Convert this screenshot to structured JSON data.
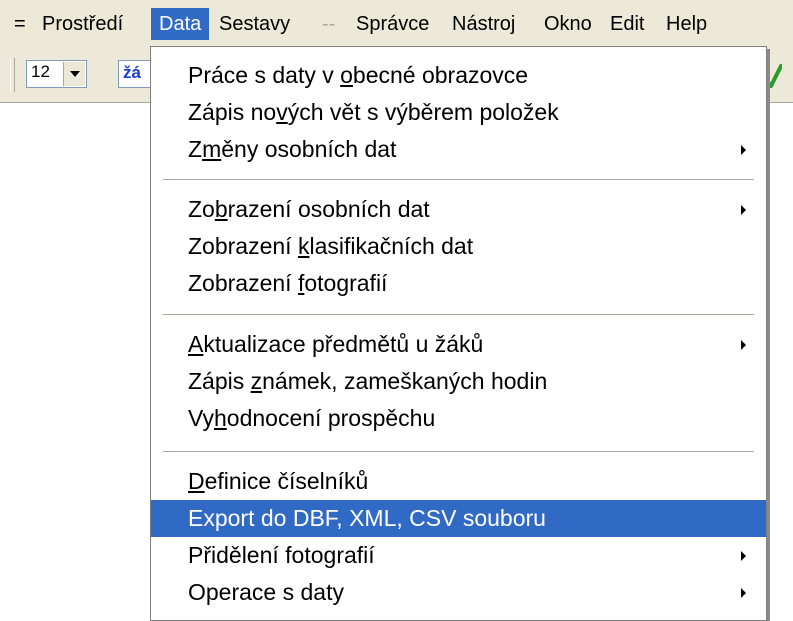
{
  "menubar": {
    "system": "=",
    "items": [
      "Prostředí",
      "Data",
      "Sestavy",
      "--",
      "Správce",
      "Nástroj",
      "Okno",
      "Edit",
      "Help"
    ]
  },
  "toolbar": {
    "size_value": "12",
    "font_value": "žá"
  },
  "menu": {
    "items": [
      {
        "label": "Práce s daty v obecné obrazovce",
        "mnemonic": "o"
      },
      {
        "label": "Zápis nových vět s výběrem položek",
        "mnemonic": "v"
      },
      {
        "label": "Změny osobních dat",
        "mnemonic": "m",
        "submenu": true
      },
      {
        "label": "Zobrazení osobních dat",
        "mnemonic": "b",
        "submenu": true
      },
      {
        "label": "Zobrazení klasifikačních dat",
        "mnemonic": "k"
      },
      {
        "label": "Zobrazení fotografií",
        "mnemonic": "f"
      },
      {
        "label": "Aktualizace předmětů u žáků",
        "mnemonic": "A",
        "submenu": true
      },
      {
        "label": "Zápis známek, zameškaných hodin",
        "mnemonic": "z"
      },
      {
        "label": "Vyhodnocení prospěchu",
        "mnemonic": "h"
      },
      {
        "label": "Definice číselníků",
        "mnemonic": "D"
      },
      {
        "label": "Export do DBF,  XML, CSV souboru",
        "mnemonic": "",
        "highlighted": true
      },
      {
        "label": "Přidělení fotografií",
        "mnemonic": "",
        "submenu": true
      },
      {
        "label": "Operace s daty",
        "mnemonic": "",
        "submenu": true
      }
    ]
  },
  "colors": {
    "menu_bar_bg": "#ece9d8",
    "highlight": "#316ac5",
    "disabled_text": "#aca899"
  },
  "icons": {
    "combo_button": "chevron-down-icon",
    "submenu": "chevron-right-icon",
    "toolbar_right": "green-checkmark-icon"
  }
}
